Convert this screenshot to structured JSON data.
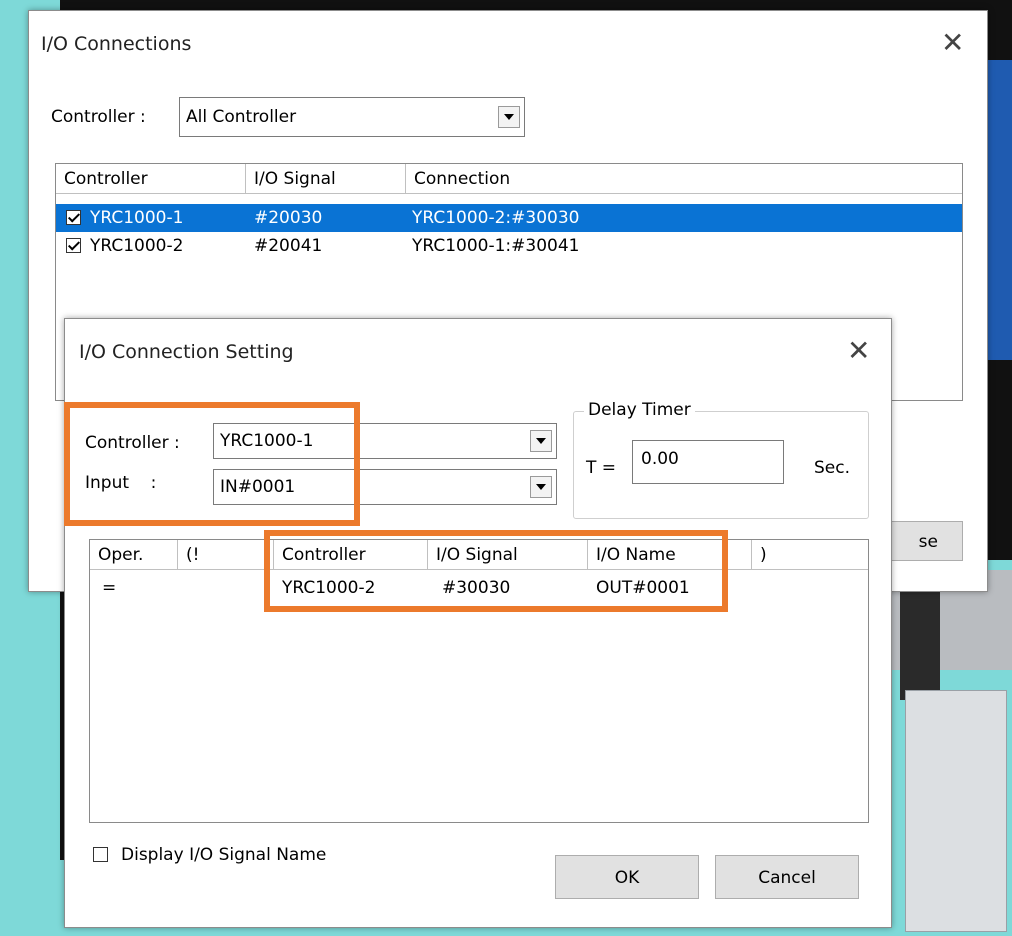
{
  "outer": {
    "title": "I/O Connections",
    "controller_label": "Controller :",
    "controller_value": "All Controller",
    "columns": [
      "Controller",
      "I/O Signal",
      "Connection"
    ],
    "rows": [
      {
        "controller": "YRC1000-1",
        "signal": "#20030",
        "connection": "YRC1000-2:#30030",
        "checked": true,
        "selected": true
      },
      {
        "controller": "YRC1000-2",
        "signal": "#20041",
        "connection": "YRC1000-1:#30041",
        "checked": true,
        "selected": false
      }
    ],
    "partial_button_text": "se"
  },
  "inner": {
    "title": "I/O Connection Setting",
    "controller_label": "Controller :",
    "controller_value": "YRC1000-1",
    "input_label": "Input    :",
    "input_value": "IN#0001",
    "delay_timer": {
      "group_label": "Delay Timer",
      "t_label": "T =",
      "value": "0.00",
      "unit": "Sec."
    },
    "columns": [
      "Oper.",
      "(!",
      "Controller",
      "I/O Signal",
      "I/O Name",
      ")"
    ],
    "rows": [
      {
        "oper": "=",
        "not": "",
        "controller": "YRC1000-2",
        "signal": "#30030",
        "name": "OUT#0001",
        "close": ""
      }
    ],
    "display_signal_name_label": "Display I/O Signal Name",
    "ok_label": "OK",
    "cancel_label": "Cancel"
  },
  "colors": {
    "highlight": "#ec7a2c",
    "selection": "#0a73d4"
  },
  "icons": {
    "close": "close-icon",
    "dropdown": "chevron-down-icon",
    "check": "check-icon"
  }
}
